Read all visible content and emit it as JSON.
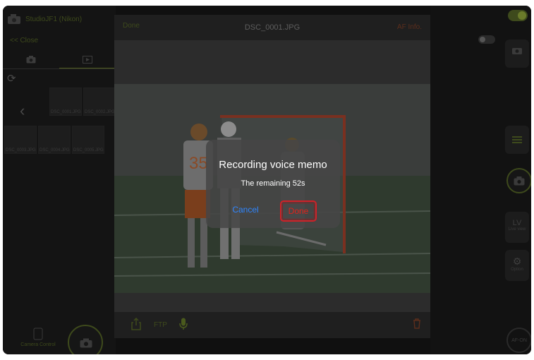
{
  "app": {
    "camera_name": "StudioJF1 (Nikon)",
    "close_link": "<< Close"
  },
  "viewer": {
    "done_label": "Done",
    "filename": "DSC_0001.JPG",
    "af_info_label": "AF Info."
  },
  "toolbar": {
    "ftp_label": "FTP",
    "icons": [
      "share-icon",
      "microphone-icon",
      "trash-icon"
    ]
  },
  "thumbnails": [
    {
      "label": "DSC_0001.JPG"
    },
    {
      "label": "DSC_0002.JPG"
    },
    {
      "label": "DSC_0003.JPG"
    },
    {
      "label": "DSC_0004.JPG"
    },
    {
      "label": "DSC_0005.JPG"
    }
  ],
  "left_panel": {
    "camera_control_label": "Camera Control"
  },
  "right_panel": {
    "lv_label": "LV",
    "lv_sub": "Live view",
    "option_label": "Option",
    "af_on_label": "AF-ON"
  },
  "dialog": {
    "title": "Recording voice memo",
    "message": "The remaining 52s",
    "cancel_label": "Cancel",
    "done_label": "Done"
  },
  "colors": {
    "accent_green": "#6a7a2a",
    "cancel_blue": "#2f86ff",
    "done_red": "#e0231b",
    "highlight_border": "#d31f26"
  }
}
